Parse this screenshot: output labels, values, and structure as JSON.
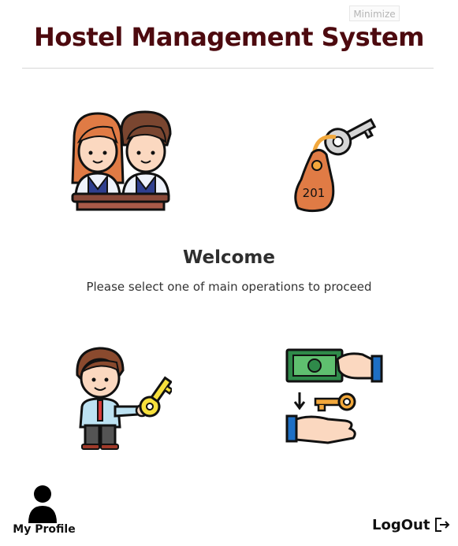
{
  "window": {
    "minimize_label": "Minimize"
  },
  "header": {
    "title": "Hostel Management System"
  },
  "tiles": {
    "students": {
      "icon": "students-icon"
    },
    "room_key": {
      "icon": "room-key-tag-icon",
      "tag_number": "201"
    },
    "allocation": {
      "icon": "staff-with-key-icon"
    },
    "payment": {
      "icon": "payment-exchange-icon"
    }
  },
  "welcome": {
    "heading": "Welcome",
    "subtitle": "Please select one of main operations to proceed"
  },
  "footer": {
    "profile_label": "My Profile",
    "logout_label": "LogOut"
  },
  "colors": {
    "title": "#4d0a0f",
    "background": "#ffffff"
  }
}
